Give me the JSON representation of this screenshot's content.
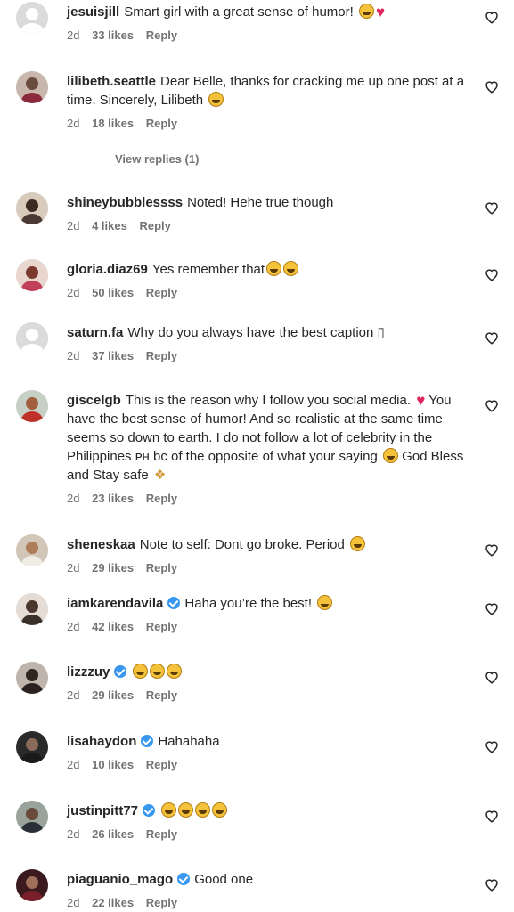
{
  "comments": [
    {
      "username": "jesuisjill",
      "verified": false,
      "text": "Smart girl with a great sense of humor!",
      "age": "2d",
      "likes": "33 likes",
      "reply": "Reply",
      "avatar": "default-avatar",
      "emojis": [
        "smile",
        "heart"
      ]
    },
    {
      "username": "lilibeth.seattle",
      "verified": false,
      "text": "Dear Belle, thanks for cracking me up one post at a time. Sincerely, Lilibeth",
      "age": "2d",
      "likes": "18 likes",
      "reply": "Reply",
      "avatar": "profile-photo",
      "emojis": [
        "laugh"
      ]
    },
    {
      "username": "shineybubblessss",
      "verified": false,
      "text": "Noted! Hehe true though",
      "age": "2d",
      "likes": "4 likes",
      "reply": "Reply",
      "avatar": "profile-photo",
      "emojis": []
    },
    {
      "username": "gloria.diaz69",
      "verified": false,
      "text": "Yes remember that",
      "age": "2d",
      "likes": "50 likes",
      "reply": "Reply",
      "avatar": "profile-photo",
      "emojis": [
        "laugh",
        "laugh"
      ]
    },
    {
      "username": "saturn.fa",
      "verified": false,
      "text": "Why do you always have the best caption ▯",
      "age": "2d",
      "likes": "37 likes",
      "reply": "Reply",
      "avatar": "default-avatar",
      "emojis": []
    },
    {
      "username": "giscelgb",
      "verified": false,
      "text": "This is the reason why I follow you social media.",
      "text2": "You have the best sense of humor! And so realistic at the same time seems so down to earth. I do not follow a lot of celebrity in the Philippines ᴘʜ bc of the opposite of what your saying",
      "text3": "God Bless and Stay safe",
      "age": "2d",
      "likes": "23 likes",
      "reply": "Reply",
      "avatar": "profile-photo",
      "emojis": []
    },
    {
      "username": "sheneskaa",
      "verified": false,
      "text": "Note to self: Dont go broke. Period",
      "age": "2d",
      "likes": "29 likes",
      "reply": "Reply",
      "avatar": "profile-photo",
      "emojis": [
        "laugh"
      ]
    },
    {
      "username": "iamkarendavila",
      "verified": true,
      "text": "Haha you’re the best!",
      "age": "2d",
      "likes": "42 likes",
      "reply": "Reply",
      "avatar": "profile-photo",
      "emojis": [
        "grin"
      ]
    },
    {
      "username": "lizzzuy",
      "verified": true,
      "text": "",
      "age": "2d",
      "likes": "29 likes",
      "reply": "Reply",
      "avatar": "profile-photo",
      "emojis": [
        "laugh",
        "laugh",
        "laugh"
      ]
    },
    {
      "username": "lisahaydon",
      "verified": true,
      "text": "Hahahaha",
      "age": "2d",
      "likes": "10 likes",
      "reply": "Reply",
      "avatar": "profile-photo",
      "emojis": []
    },
    {
      "username": "justinpitt77",
      "verified": true,
      "text": "",
      "age": "2d",
      "likes": "26 likes",
      "reply": "Reply",
      "avatar": "profile-photo",
      "emojis": [
        "laugh",
        "laugh",
        "laugh",
        "laugh"
      ]
    },
    {
      "username": "piaguanio_mago",
      "verified": true,
      "text": "Good one",
      "age": "2d",
      "likes": "22 likes",
      "reply": "Reply",
      "avatar": "profile-photo",
      "emojis": []
    }
  ],
  "view_replies": "View replies (1)",
  "colors": {
    "text": "#262626",
    "meta": "#737373",
    "verified": "#3897f0",
    "heart": "#e0245e"
  }
}
